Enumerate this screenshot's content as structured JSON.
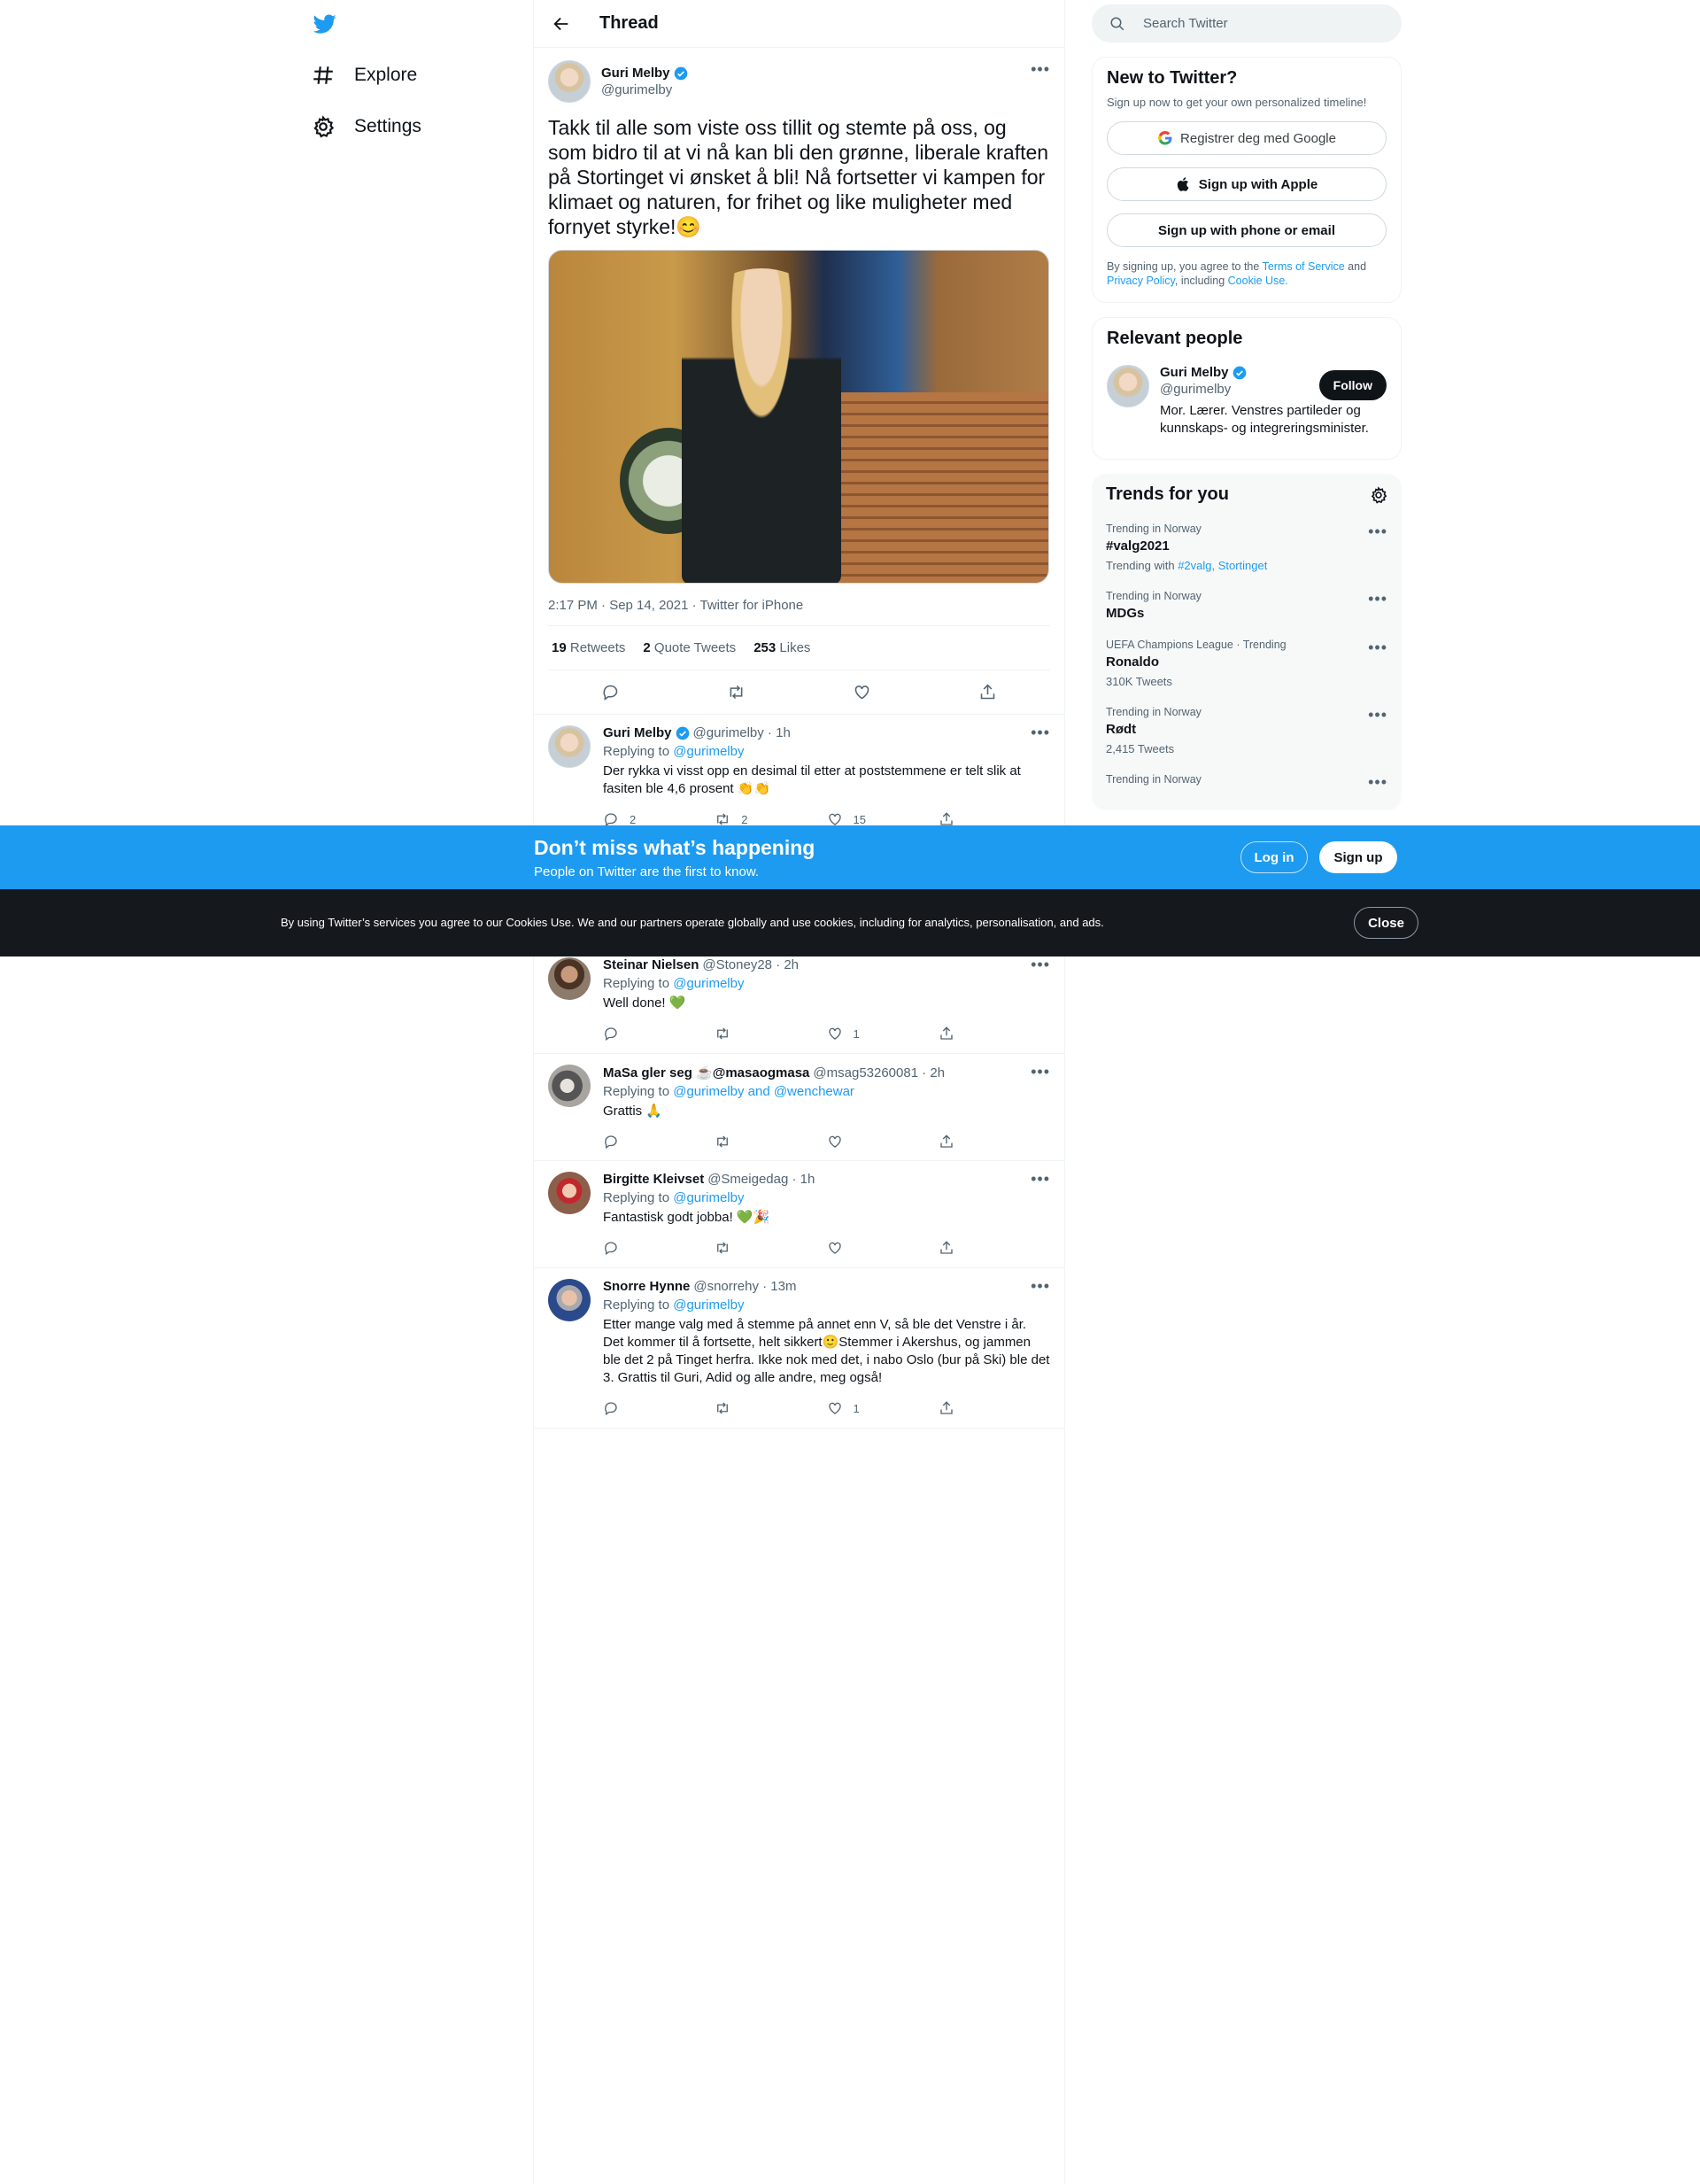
{
  "nav": {
    "items": [
      {
        "label": "Explore",
        "icon": "hashtag-icon"
      },
      {
        "label": "Settings",
        "icon": "gear-icon"
      }
    ]
  },
  "thread": {
    "header_title": "Thread",
    "main": {
      "name": "Guri Melby",
      "handle": "@gurimelby",
      "text": "Takk til alle som viste oss tillit og stemte på oss, og som bidro til at vi nå kan bli den grønne, liberale kraften på Stortinget vi ønsket å bli! Nå fortsetter vi kampen for klimaet og naturen, for frihet og like muligheter med fornyet styrke!😊",
      "meta": "2:17 PM · Sep 14, 2021 · Twitter for iPhone",
      "retweets": "19",
      "retweets_label": "Retweets",
      "quotes": "2",
      "quotes_label": "Quote Tweets",
      "likes": "253",
      "likes_label": "Likes"
    },
    "replies": [
      {
        "name": "Guri Melby",
        "handle_time": "@gurimelby · 1h",
        "replying_prefix": "Replying to",
        "replying_to": "@gurimelby",
        "text": "Der rykka vi visst opp en desimal til etter at poststemmene er telt slik at fasiten ble 4,6 prosent 👏👏",
        "replies": "2",
        "retweets": "2",
        "likes": "15"
      },
      {
        "name": "Steinar Nielsen",
        "handle_time": "@Stoney28 · 2h",
        "replying_prefix": "Replying to",
        "replying_to": "@gurimelby",
        "text": "Well done! 💚",
        "replies": "",
        "retweets": "",
        "likes": "1"
      },
      {
        "name": "MaSa gler seg ☕@masaogmasa",
        "handle_time": "@msag53260081 · 2h",
        "replying_prefix": "Replying to",
        "replying_to": "@gurimelby and @wenchewar",
        "text": "Grattis 🙏",
        "replies": "",
        "retweets": "",
        "likes": ""
      },
      {
        "name": "Birgitte Kleivset",
        "handle_time": "@Smeigedag · 1h",
        "replying_prefix": "Replying to",
        "replying_to": "@gurimelby",
        "text": "Fantastisk godt jobba! 💚🎉",
        "replies": "",
        "retweets": "",
        "likes": ""
      },
      {
        "name": "Snorre Hynne",
        "handle_time": "@snorrehy · 13m",
        "replying_prefix": "Replying to",
        "replying_to": "@gurimelby",
        "text": "Etter mange valg med å stemme på annet enn V, så ble det Venstre i år. Det kommer til å fortsette, helt sikkert🙂Stemmer i Akershus, og jammen ble det 2 på Tinget herfra. Ikke nok med det, i nabo Oslo (bur på Ski) ble det 3. Grattis til Guri, Adid og alle andre, meg også!",
        "replies": "",
        "retweets": "",
        "likes": "1"
      }
    ]
  },
  "sidebar": {
    "search_placeholder": "Search Twitter",
    "new_title": "New to Twitter?",
    "new_sub": "Sign up now to get your own personalized timeline!",
    "google_label": "Registrer deg med Google",
    "apple_label": "Sign up with Apple",
    "phone_label": "Sign up with phone or email",
    "legal_1": "By signing up, you agree to the",
    "legal_terms": "Terms of Service",
    "legal_2": "and",
    "legal_privacy": "Privacy Policy",
    "legal_3": ", including",
    "legal_cookie": "Cookie Use.",
    "relevant_title": "Relevant people",
    "relevant": {
      "name": "Guri Melby",
      "handle": "@gurimelby",
      "bio": "Mor. Lærer. Venstres partileder og kunnskaps- og integreringsminister.",
      "follow_label": "Follow"
    },
    "trends_title": "Trends for you",
    "trends": [
      {
        "context": "Trending in Norway",
        "topic": "#valg2021",
        "extra_prefix": "Trending with",
        "extra_links": "#2valg, Stortinget",
        "count": ""
      },
      {
        "context": "Trending in Norway",
        "topic": "MDGs",
        "extra_prefix": "",
        "extra_links": "",
        "count": ""
      },
      {
        "context": "UEFA Champions League · Trending",
        "topic": "Ronaldo",
        "extra_prefix": "",
        "extra_links": "",
        "count": "310K Tweets"
      },
      {
        "context": "Trending in Norway",
        "topic": "Rødt",
        "extra_prefix": "",
        "extra_links": "",
        "count": "2,415 Tweets"
      },
      {
        "context": "Trending in Norway",
        "topic": "",
        "extra_prefix": "",
        "extra_links": "",
        "count": ""
      }
    ]
  },
  "banner": {
    "title": "Don’t miss what’s happening",
    "subtitle": "People on Twitter are the first to know.",
    "login_label": "Log in",
    "signup_label": "Sign up"
  },
  "cookie": {
    "text": "By using Twitter’s services you agree to our Cookies Use. We and our partners operate globally and use cookies, including for analytics, personalisation, and ads.",
    "close_label": "Close"
  },
  "colors": {
    "accent": "#1d9bf0",
    "text": "#0f1419",
    "secondary": "#536471",
    "cookie_bg": "#15181c"
  }
}
